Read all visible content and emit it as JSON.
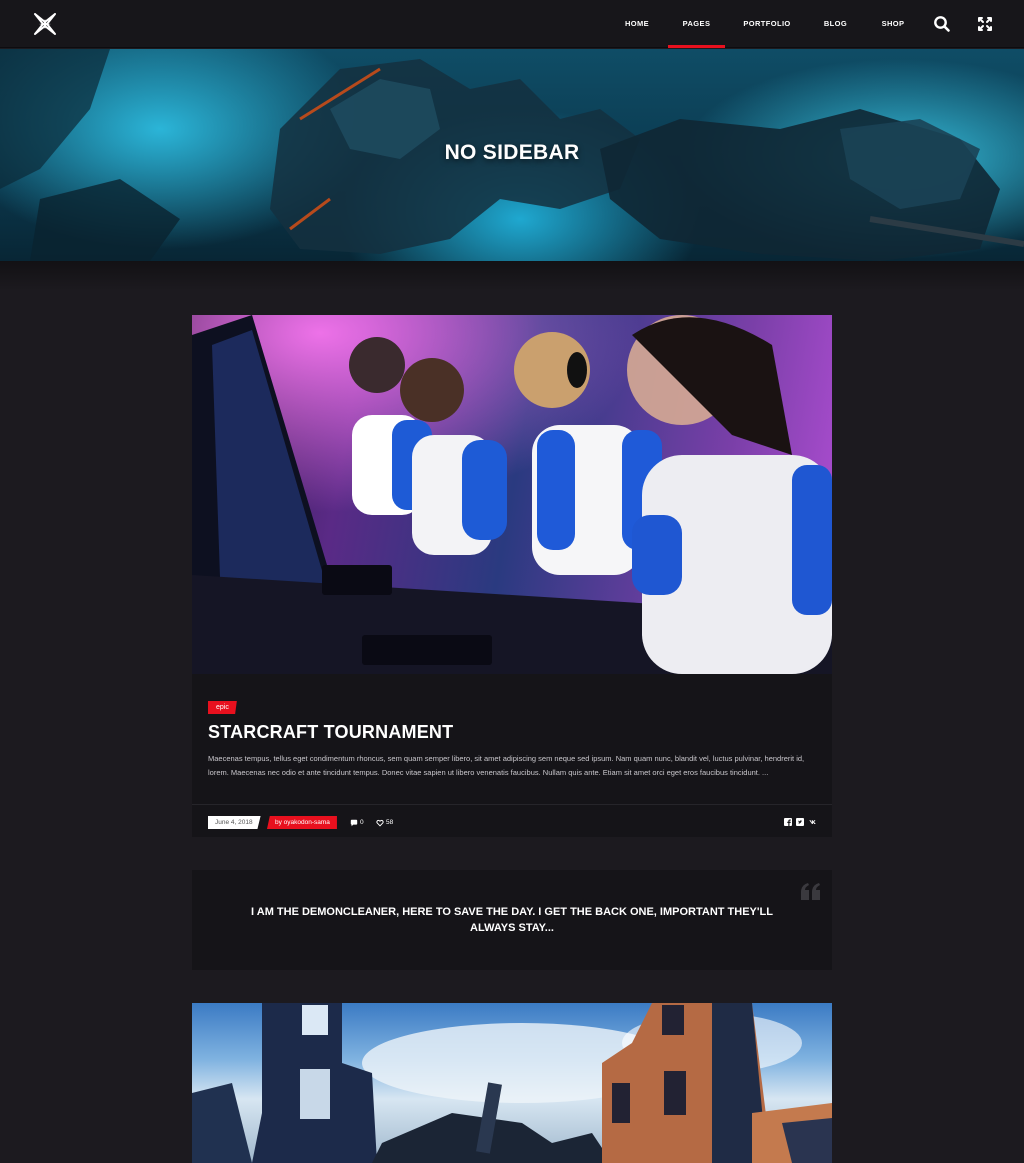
{
  "header": {
    "logo": "brand-logo",
    "nav": [
      {
        "label": "HOME",
        "active": false
      },
      {
        "label": "PAGES",
        "active": true
      },
      {
        "label": "PORTFOLIO",
        "active": false
      },
      {
        "label": "BLOG",
        "active": false
      },
      {
        "label": "SHOP",
        "active": false
      }
    ],
    "icons": [
      "search-icon",
      "fullscreen-icon"
    ],
    "accent_color": "#e8101e"
  },
  "hero": {
    "title": "NO SIDEBAR"
  },
  "post": {
    "tag": "epic",
    "title": "STARCRAFT TOURNAMENT",
    "excerpt": "Maecenas tempus, tellus eget condimentum rhoncus, sem quam semper libero, sit amet adipiscing sem neque sed ipsum. Nam quam nunc, blandit vel, luctus pulvinar, hendrerit id, lorem. Maecenas nec odio et ante tincidunt tempus. Donec vitae sapien ut libero venenatis faucibus. Nullam quis ante. Etiam sit amet orci eget eros faucibus tincidunt. ...",
    "date": "June 4, 2018",
    "author": "by oyakodon-sama",
    "comments": "0",
    "likes": "58",
    "share_icons": [
      "facebook-icon",
      "twitter-icon",
      "vk-icon"
    ]
  },
  "quote": {
    "text": "I AM THE DEMONCLEANER, HERE TO SAVE THE DAY. I GET THE BACK ONE, IMPORTANT THEY'LL ALWAYS STAY..."
  }
}
